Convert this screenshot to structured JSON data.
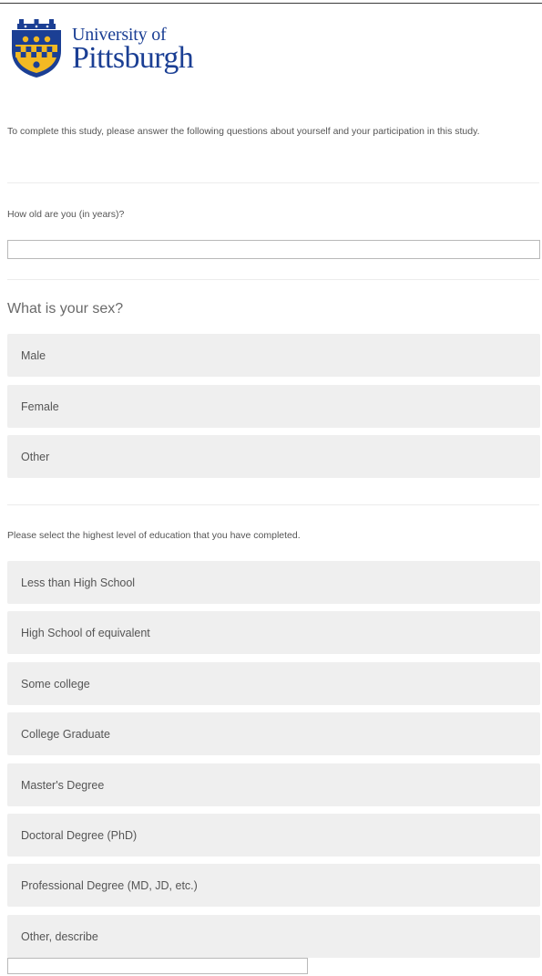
{
  "header": {
    "logo_line1": "University of",
    "logo_line2": "Pittsburgh",
    "colors": {
      "brand_blue": "#1b3f94",
      "brand_gold": "#f2b923"
    }
  },
  "intro": {
    "text": "To complete this study, please answer the following questions about yourself and your participation in this study."
  },
  "age_question": {
    "label": "How old are you (in years)?",
    "value": ""
  },
  "sex_question": {
    "label": "What is your sex?",
    "options": [
      {
        "label": "Male"
      },
      {
        "label": "Female"
      },
      {
        "label": "Other"
      }
    ]
  },
  "education_question": {
    "label": "Please select the highest level of education that you have completed.",
    "options": [
      {
        "label": "Less than High School"
      },
      {
        "label": "High School of equivalent"
      },
      {
        "label": "Some college"
      },
      {
        "label": "College Graduate"
      },
      {
        "label": "Master's Degree"
      },
      {
        "label": "Doctoral Degree (PhD)"
      },
      {
        "label": "Professional Degree (MD, JD, etc.)"
      },
      {
        "label": "Other, describe"
      }
    ],
    "other_value": ""
  },
  "theme": {
    "choice_bg": "#efefef",
    "divider": "#ececec",
    "text": "#555555"
  }
}
